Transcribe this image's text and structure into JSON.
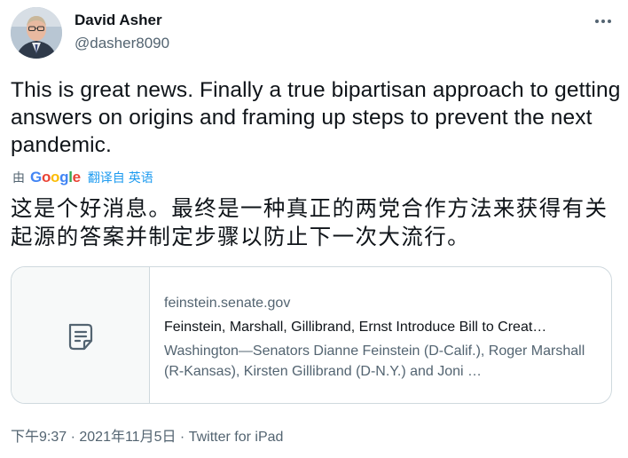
{
  "author": {
    "name": "David Asher",
    "handle": "@dasher8090"
  },
  "tweet": {
    "text": "This is great news. Finally a true bipartisan approach to getting answers on origins and framing up steps to prevent the next pandemic."
  },
  "translation": {
    "by_label": "由",
    "provider": "Google",
    "link_label": "翻译自 英语",
    "text": "这是个好消息。最终是一种真正的两党合作方法来获得有关起源的答案并制定步骤以防止下一次大流行。"
  },
  "link_card": {
    "domain": "feinstein.senate.gov",
    "title": "Feinstein, Marshall, Gillibrand, Ernst Introduce Bill to Creat…",
    "description": "Washington—Senators Dianne Feinstein (D-Calif.), Roger Marshall (R-Kansas), Kirsten Gillibrand (D-N.Y.) and Joni …",
    "thumbnail_icon": "document-icon"
  },
  "meta": {
    "time": "下午9:37",
    "separator1": " · ",
    "date": "2021年11月5日",
    "separator2": " · ",
    "source": "Twitter for iPad"
  },
  "icons": {
    "more": "more-horizontal-icon"
  },
  "colors": {
    "accent": "#1d9bf0",
    "text": "#0f1419",
    "secondary": "#536471",
    "border": "#cfd9de"
  }
}
